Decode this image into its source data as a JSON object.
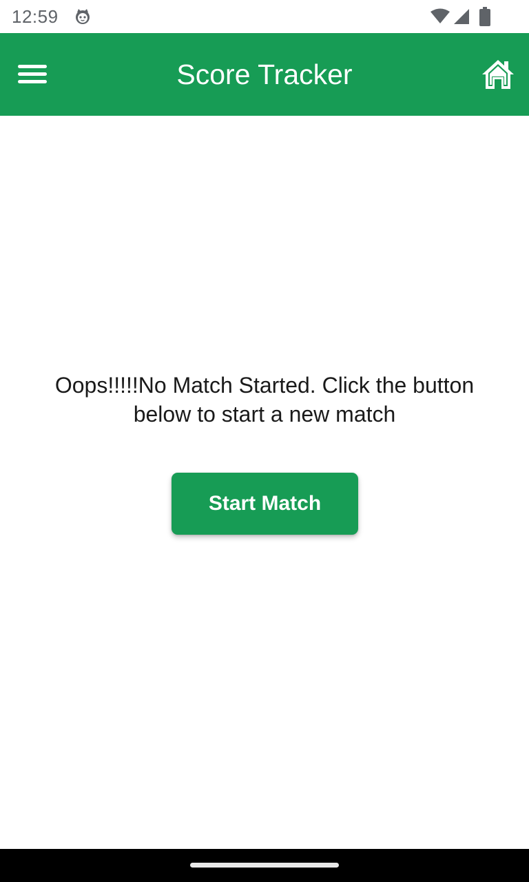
{
  "status_bar": {
    "time": "12:59",
    "icons": [
      "cat-notification-icon",
      "wifi-icon",
      "signal-icon",
      "battery-icon"
    ]
  },
  "app_bar": {
    "title": "Score Tracker",
    "left_icon": "menu-icon",
    "right_icon": "home-icon",
    "color": "#179c55"
  },
  "main": {
    "message_line1": "Oops!!!!!No Match Started. Click the button",
    "message_line2": "below to start a new match",
    "start_button_label": "Start Match",
    "accent_color": "#179c55"
  }
}
